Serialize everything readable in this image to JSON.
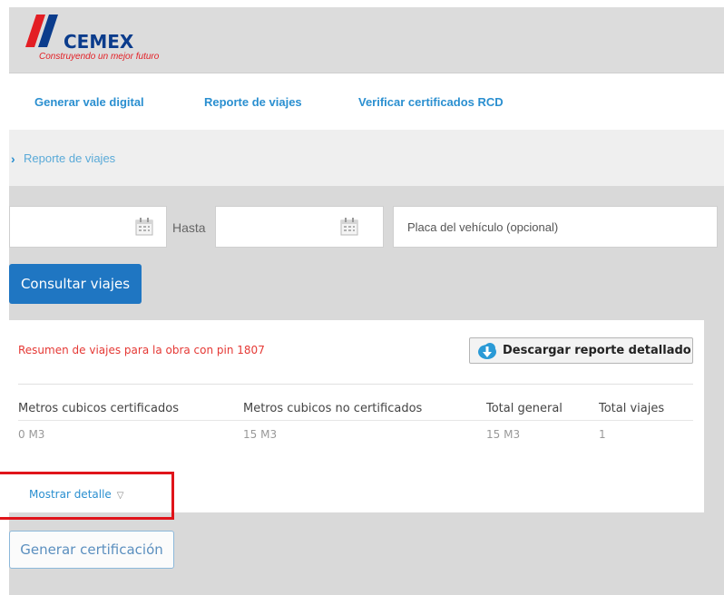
{
  "header": {
    "brand": "CEMEX",
    "tagline": "Construyendo un mejor futuro",
    "colors": {
      "brand_blue": "#0b3c8c",
      "brand_red": "#e31e24"
    }
  },
  "nav": {
    "items": [
      {
        "label": "Generar vale digital"
      },
      {
        "label": "Reporte de viajes"
      },
      {
        "label": "Verificar certificados RCD"
      }
    ]
  },
  "breadcrumb": {
    "current": "Reporte de viajes"
  },
  "filters": {
    "desde_value": "",
    "hasta_label": "Hasta",
    "hasta_value": "",
    "placa_placeholder": "Placa del vehículo (opcional)",
    "consultar_label": "Consultar viajes"
  },
  "resumen": {
    "title": "Resumen de viajes para la obra con pin 1807",
    "download_label": "Descargar reporte detallado",
    "columns": [
      "Metros cubicos certificados",
      "Metros cubicos no certificados",
      "Total general",
      "Total viajes"
    ],
    "row": [
      "0 M3",
      "15 M3",
      "15 M3",
      "1"
    ],
    "mostrar_detalle": "Mostrar detalle"
  },
  "actions": {
    "generar_label": "Generar certificación"
  },
  "icons": [
    "calendar-icon",
    "cloud-download-icon",
    "chevron-right-icon",
    "triangle-down-icon"
  ]
}
